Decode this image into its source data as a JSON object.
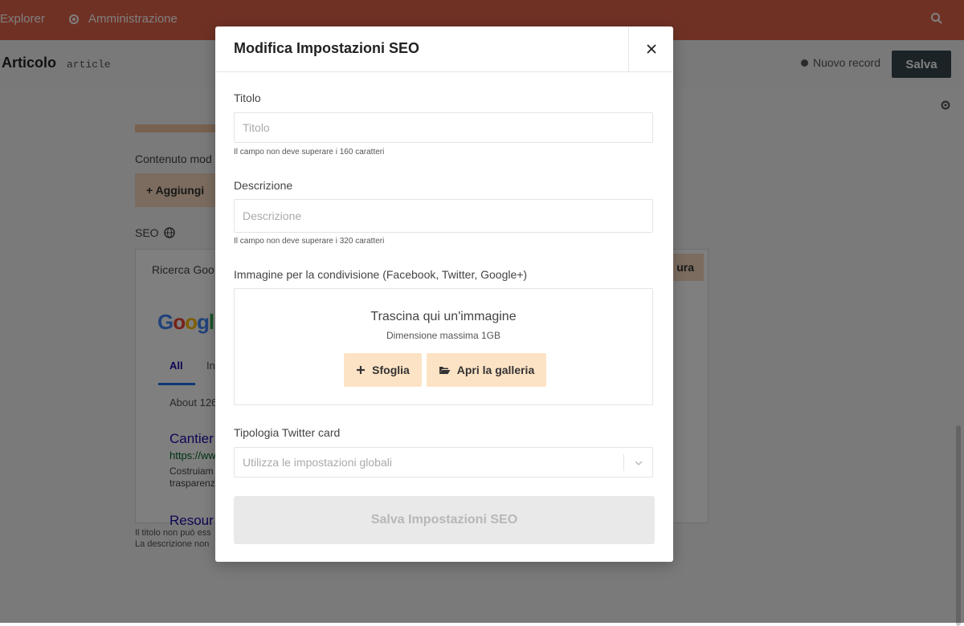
{
  "app": {
    "nav": {
      "explorer": "Explorer",
      "admin": "Amministrazione"
    },
    "header": {
      "title": "Articolo",
      "slug": "article",
      "status": "Nuovo record",
      "save_label": "Salva"
    },
    "content": {
      "label": "Contenuto mod",
      "add_label": "Aggiungi",
      "seo_label": "SEO",
      "seo_tab": "Ricerca Goo",
      "preview_btn": "ura",
      "google": {
        "logo": "Googl",
        "tab_all": "All",
        "tab_2": "In",
        "about": "About 126",
        "r1_title": "Cantier",
        "r1_url": "https://ww",
        "r1_desc1": "Costruiam",
        "r1_desc2": "trasparenz",
        "r2_title": "Resour"
      },
      "warn1": "Il titolo non può ess",
      "warn2": "La descrizione non"
    }
  },
  "modal": {
    "title": "Modifica Impostazioni SEO",
    "fields": {
      "title_label": "Titolo",
      "title_placeholder": "Titolo",
      "title_hint": "Il campo non deve superare i 160 caratteri",
      "desc_label": "Descrizione",
      "desc_placeholder": "Descrizione",
      "desc_hint": "Il campo non deve superare i 320 caratteri",
      "image_label": "Immagine per la condivisione (Facebook, Twitter, Google+)",
      "dropzone_title": "Trascina qui un'immagine",
      "dropzone_sub": "Dimensione massima 1GB",
      "browse_label": "Sfoglia",
      "gallery_label": "Apri la galleria",
      "twitter_label": "Tipologia Twitter card",
      "twitter_value": "Utilizza le impostazioni globali"
    },
    "submit_label": "Salva Impostazioni SEO"
  },
  "colors": {
    "topbar": "#e0634a",
    "accent_button": "#fde3c5",
    "dark_button": "#37474f"
  },
  "icons": [
    "gear-icon",
    "search-icon",
    "globe-icon",
    "close-icon",
    "plus-icon",
    "folder-open-icon",
    "chevron-down-icon"
  ]
}
